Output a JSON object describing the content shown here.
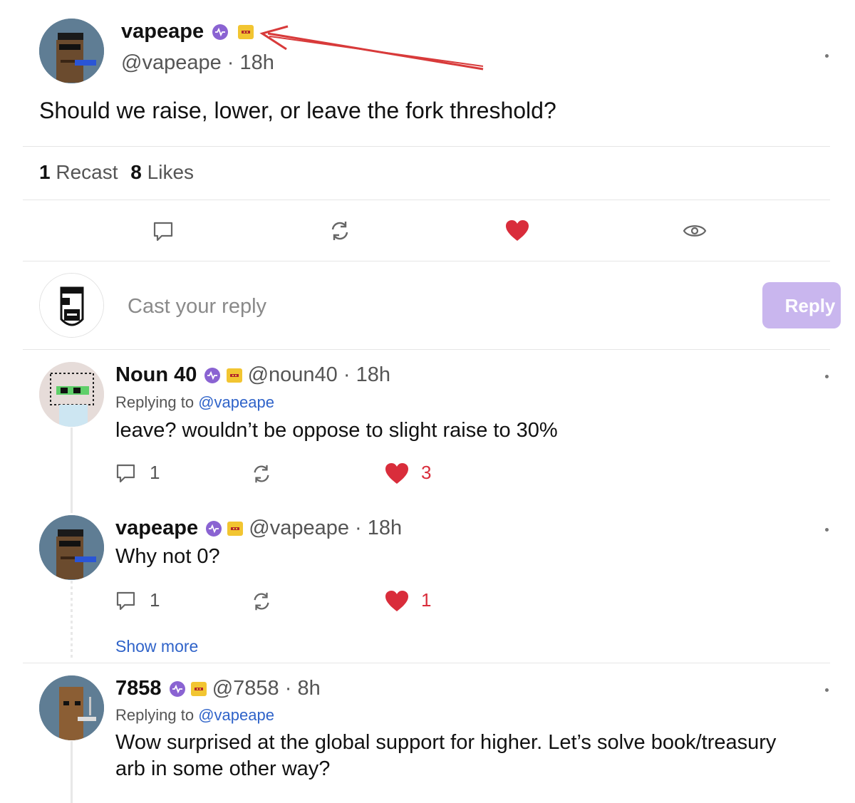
{
  "post": {
    "author_name": "vapeape",
    "handle": "@vapeape",
    "time": "18h",
    "text": "Should we raise, lower, or leave the fork threshold?",
    "recast_count": "1",
    "recast_label": "Recast",
    "likes_count": "8",
    "likes_label": "Likes",
    "annotation_color": "#d83a3a"
  },
  "composer": {
    "placeholder": "Cast your reply",
    "button_label": "Reply"
  },
  "replies": [
    {
      "author_name": "Noun 40",
      "handle": "@noun40",
      "time": "18h",
      "replying_prefix": "Replying to",
      "replying_to": "@vapeape",
      "text": "leave? wouldn’t be oppose to slight raise to 30%",
      "comment_count": "1",
      "like_count": "3"
    },
    {
      "author_name": "vapeape",
      "handle": "@vapeape",
      "time": "18h",
      "text": "Why not 0?",
      "comment_count": "1",
      "like_count": "1",
      "show_more": "Show more"
    },
    {
      "author_name": "7858",
      "handle": "@7858",
      "time": "8h",
      "replying_prefix": "Replying to",
      "replying_to": "@vapeape",
      "text_line1": "Wow surprised at the global support for higher. Let’s solve book/treasury",
      "text_line2": "arb in some other way?"
    }
  ],
  "colors": {
    "like": "#d92d3b",
    "link": "#2f63c9",
    "verified": "#8a63d2",
    "badge_gold": "#f2c531",
    "reply_button": "#c9b6ee"
  }
}
